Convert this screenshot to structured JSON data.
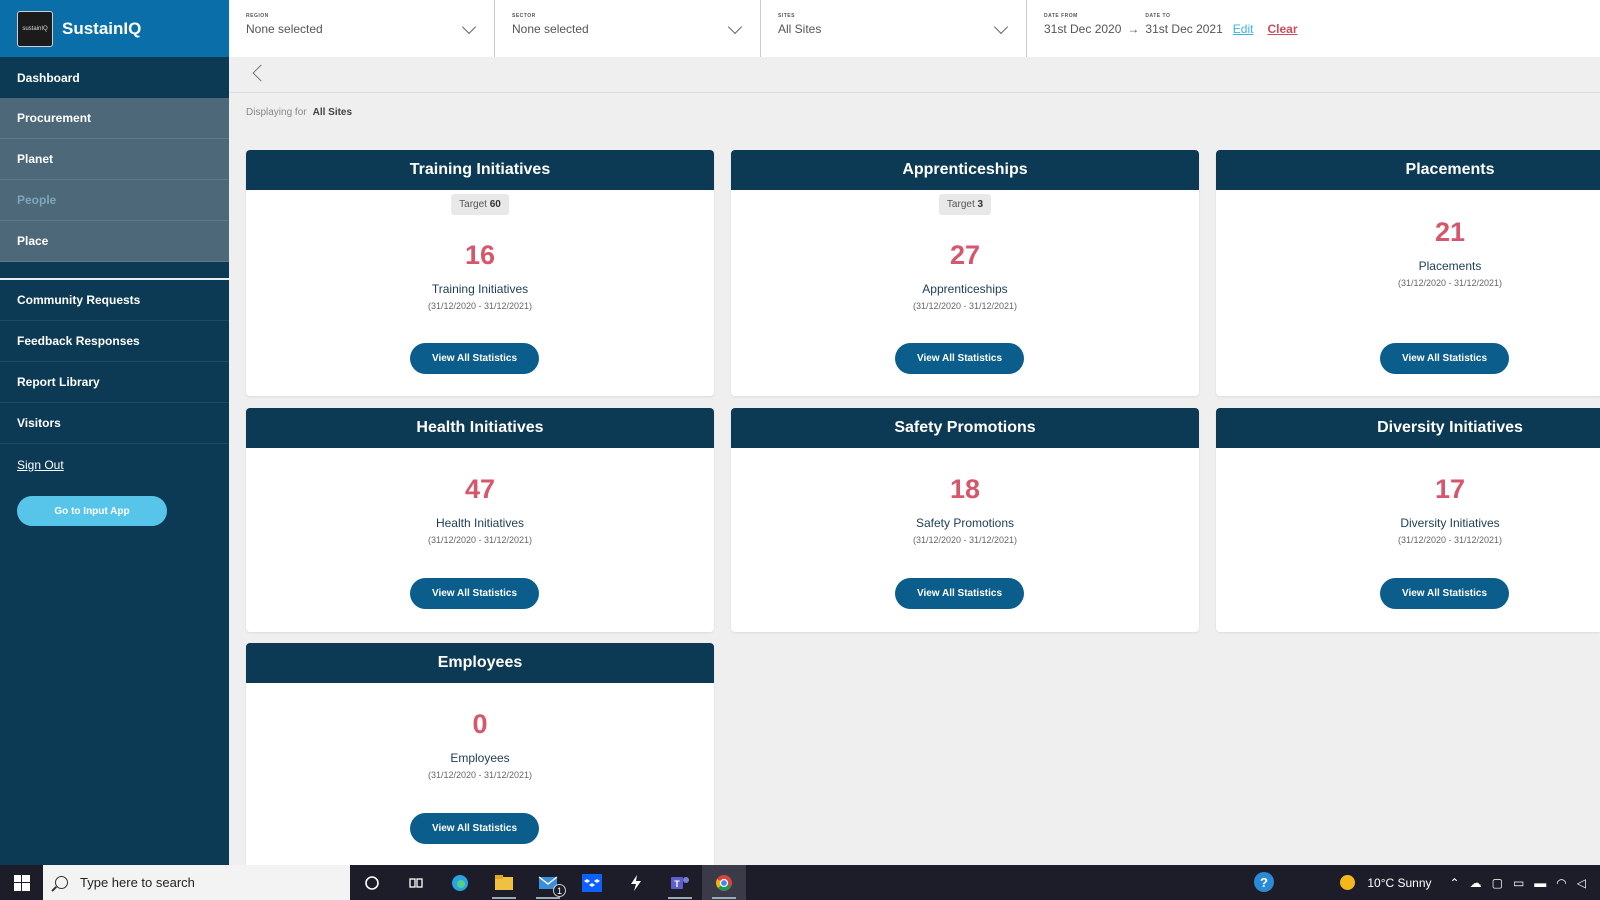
{
  "app": {
    "name": "SustainIQ",
    "logo_text": "sustainIQ"
  },
  "sidebar": {
    "dashboard": "Dashboard",
    "sub_items": [
      {
        "label": "Procurement"
      },
      {
        "label": "Planet"
      },
      {
        "label": "People"
      },
      {
        "label": "Place"
      }
    ],
    "items": [
      {
        "label": "Community Requests"
      },
      {
        "label": "Feedback Responses"
      },
      {
        "label": "Report Library"
      },
      {
        "label": "Visitors"
      }
    ],
    "sign_out": "Sign Out",
    "input_app_button": "Go to Input App"
  },
  "filters": {
    "region": {
      "label": "REGION",
      "value": "None selected"
    },
    "sector": {
      "label": "SECTOR",
      "value": "None selected"
    },
    "sites": {
      "label": "SITES",
      "value": "All Sites"
    },
    "date_from": {
      "label": "DATE FROM",
      "value": "31st Dec 2020"
    },
    "date_to": {
      "label": "DATE TO",
      "value": "31st Dec 2021"
    },
    "edit": "Edit",
    "clear": "Clear"
  },
  "displaying": {
    "prefix": "Displaying for",
    "value": "All Sites"
  },
  "cards": [
    {
      "title": "Training Initiatives",
      "target_prefix": "Target",
      "target": "60",
      "value": "16",
      "label": "Training Initiatives",
      "range": "(31/12/2020 - 31/12/2021)",
      "button": "View All Statistics"
    },
    {
      "title": "Apprenticeships",
      "target_prefix": "Target",
      "target": "3",
      "value": "27",
      "label": "Apprenticeships",
      "range": "(31/12/2020 - 31/12/2021)",
      "button": "View All Statistics"
    },
    {
      "title": "Placements",
      "value": "21",
      "label": "Placements",
      "range": "(31/12/2020 - 31/12/2021)",
      "button": "View All Statistics"
    },
    {
      "title": "Health Initiatives",
      "value": "47",
      "label": "Health Initiatives",
      "range": "(31/12/2020 - 31/12/2021)",
      "button": "View All Statistics"
    },
    {
      "title": "Safety Promotions",
      "value": "18",
      "label": "Safety Promotions",
      "range": "(31/12/2020 - 31/12/2021)",
      "button": "View All Statistics"
    },
    {
      "title": "Diversity Initiatives",
      "value": "17",
      "label": "Diversity Initiatives",
      "range": "(31/12/2020 - 31/12/2021)",
      "button": "View All Statistics"
    },
    {
      "title": "Employees",
      "value": "0",
      "label": "Employees",
      "range": "(31/12/2020 - 31/12/2021)",
      "button": "View All Statistics"
    }
  ],
  "taskbar": {
    "search_placeholder": "Type here to search",
    "mail_badge": "1",
    "weather": "10°C  Sunny",
    "help_glyph": "?"
  },
  "colors": {
    "sidebar": "#0c3a55",
    "brand": "#0a6fa8",
    "accent": "#d6576c",
    "button": "#0b5d8c",
    "link": "#3ab5e3"
  }
}
